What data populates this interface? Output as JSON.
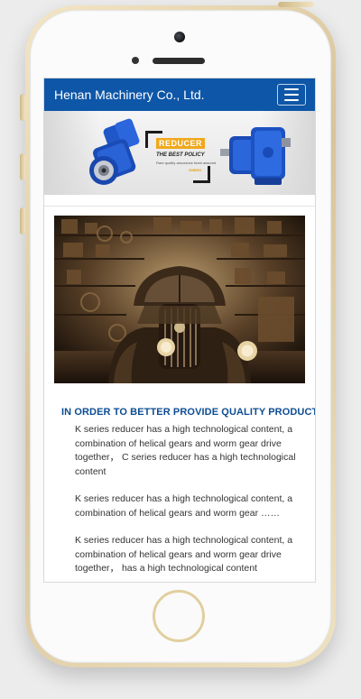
{
  "header": {
    "brand": "Henan Machinery Co., Ltd."
  },
  "banner": {
    "badge_title": "REDUCER",
    "badge_subtitle": "THE BEST POLICY",
    "badge_tagline": "Rare quality assurance team assured",
    "badge_brand": "SHBEN"
  },
  "content": {
    "section_title": "IN ORDER TO BETTER PROVIDE QUALITY PRODUCT",
    "paragraphs": [
      "K series reducer has a high technological content, a combination of helical gears and worm gear drive together， C series reducer has a high technological content",
      "K series reducer has a high technological content, a combination of helical gears and worm gear ……",
      "K series reducer has a high technological content, a combination of helical gears and worm gear drive together， has a high technological content"
    ]
  },
  "colors": {
    "navbar": "#0e56a7",
    "title": "#0d4d93",
    "reducer_blue": "#1f56c8",
    "badge_orange": "#f0a81c",
    "phone_gold": "#e1cf9f"
  },
  "icons": {
    "menu": "hamburger-icon"
  }
}
